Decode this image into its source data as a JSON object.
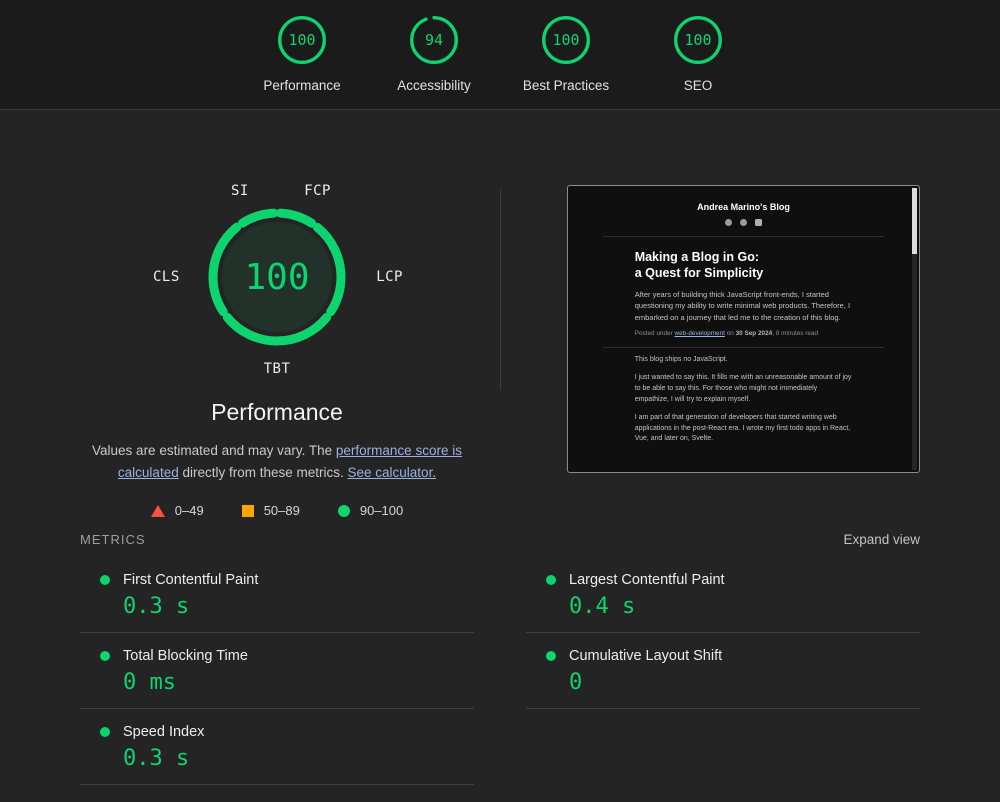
{
  "colors": {
    "pass_green": "#0ed46f",
    "fail_red": "#ff4e42",
    "average_orange": "#ffa400",
    "link_blue": "#9bb1e3"
  },
  "top_scores": [
    {
      "label": "Performance",
      "score": "100"
    },
    {
      "label": "Accessibility",
      "score": "94"
    },
    {
      "label": "Best Practices",
      "score": "100"
    },
    {
      "label": "SEO",
      "score": "100"
    }
  ],
  "gauge": {
    "score": "100",
    "title": "Performance",
    "labels": {
      "si": "SI",
      "fcp": "FCP",
      "cls": "CLS",
      "lcp": "LCP",
      "tbt": "TBT"
    }
  },
  "description": {
    "text_1": "Values are estimated and may vary. The ",
    "link_1": "performance score is calculated",
    "text_2": " directly from these metrics. ",
    "link_2": "See calculator."
  },
  "legend": [
    {
      "range": "0–49"
    },
    {
      "range": "50–89"
    },
    {
      "range": "90–100"
    }
  ],
  "screenshot": {
    "site_title": "Andrea Marino's Blog",
    "heading": "Making a Blog in Go:\na Quest for Simplicity",
    "intro": "After years of building thick JavaScript front-ends, I started questioning my ability to write minimal web products. Therefore, I embarked on a journey that led me to the creation of this blog.",
    "posted_prefix": "Posted under ",
    "posted_link": "web-development",
    "posted_mid": " on ",
    "posted_date": "30 Sep 2024",
    "posted_suffix": ", 8 minutes read",
    "para_1": "This blog ships no JavaScript.",
    "para_2": "I just wanted to say this. It fills me with an unreasonable amount of joy to be able to say this. For those who might not immediately empathize, I will try to explain myself.",
    "para_3": "I am part of that generation of developers that started writing web applications in the post-React era. I wrote my first todo apps in React, Vue, and later on, Svelte."
  },
  "metrics_section": {
    "heading": "METRICS",
    "expand": "Expand view"
  },
  "metrics": {
    "left": [
      {
        "name": "First Contentful Paint",
        "value": "0.3 s"
      },
      {
        "name": "Total Blocking Time",
        "value": "0 ms"
      },
      {
        "name": "Speed Index",
        "value": "0.3 s"
      }
    ],
    "right": [
      {
        "name": "Largest Contentful Paint",
        "value": "0.4 s"
      },
      {
        "name": "Cumulative Layout Shift",
        "value": "0"
      }
    ]
  }
}
